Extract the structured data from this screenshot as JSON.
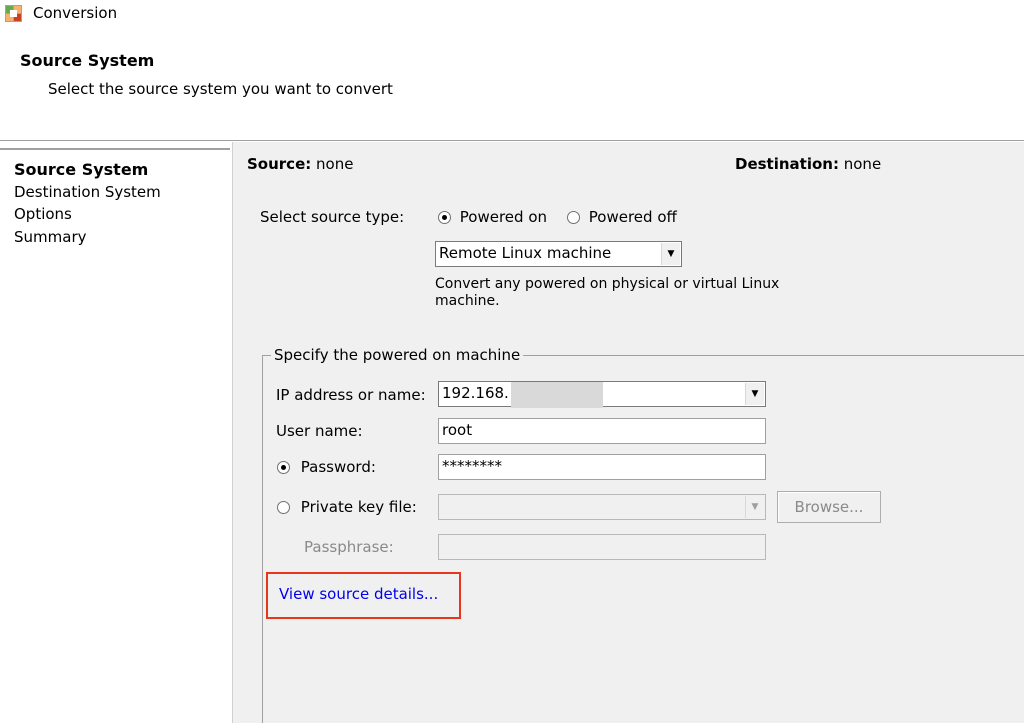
{
  "window": {
    "title": "Conversion"
  },
  "header": {
    "title": "Source System",
    "subtitle": "Select the source system you want to convert"
  },
  "nav": {
    "items": [
      {
        "label": "Source System",
        "active": true
      },
      {
        "label": "Destination System",
        "active": false
      },
      {
        "label": "Options",
        "active": false
      },
      {
        "label": "Summary",
        "active": false
      }
    ]
  },
  "summary": {
    "source_label": "Source:",
    "source_value": "none",
    "destination_label": "Destination:",
    "destination_value": "none"
  },
  "source_type": {
    "label": "Select source type:",
    "powered_on": "Powered on",
    "powered_off": "Powered off",
    "selected": "Powered on",
    "machine_type": "Remote Linux machine",
    "description_line1": "Convert any powered on physical or virtual Linux",
    "description_line2": "machine."
  },
  "machine": {
    "group_label": "Specify the powered on machine",
    "ip_label": "IP address or name:",
    "ip_value": "192.168.",
    "user_label": "User name:",
    "user_value": "root",
    "password_label": "Password:",
    "password_value": "********",
    "key_label": "Private key file:",
    "key_value": "",
    "browse_label": "Browse...",
    "passphrase_label": "Passphrase:",
    "passphrase_value": "",
    "auth_selected": "Password"
  },
  "links": {
    "view_source_details": "View source details..."
  },
  "colors": {
    "link": "#0000ee",
    "highlight": "#e8361c",
    "panel_bg": "#f0f0f0"
  },
  "icons": {
    "app": "conversion-app-icon"
  }
}
